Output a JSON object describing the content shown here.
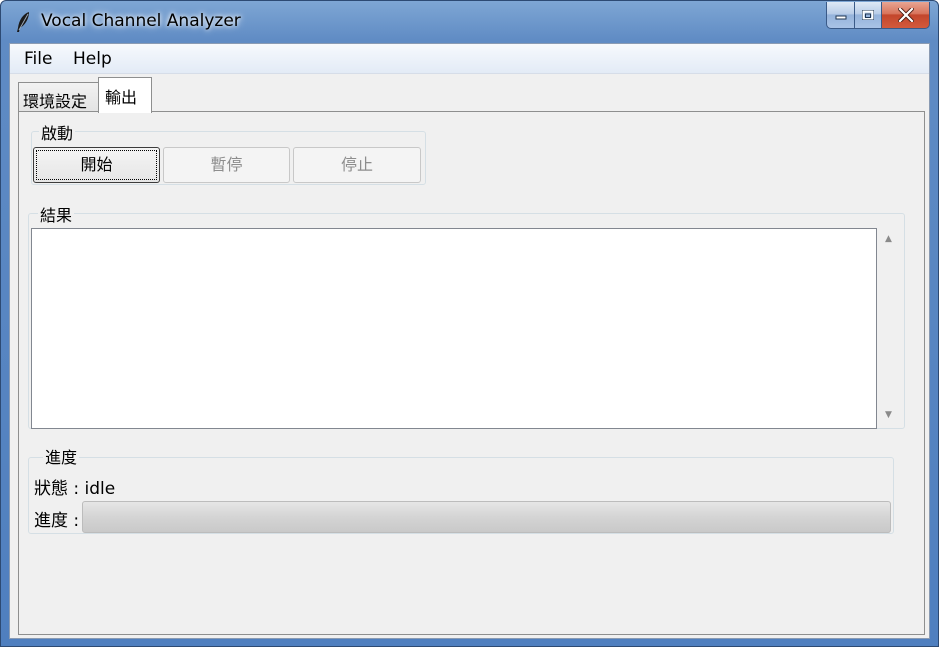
{
  "window": {
    "title": "Vocal Channel Analyzer",
    "app_icon": "feather-icon",
    "controls": {
      "minimize_icon": "minimize-icon",
      "maximize_icon": "maximize-icon",
      "close_icon": "close-icon"
    }
  },
  "menu": {
    "items": [
      "File",
      "Help"
    ]
  },
  "tabs": [
    {
      "label": "環境設定",
      "selected": false
    },
    {
      "label": "輸出",
      "selected": true
    }
  ],
  "start_group": {
    "label": "啟動",
    "buttons": [
      {
        "label": "開始",
        "enabled": true
      },
      {
        "label": "暫停",
        "enabled": false
      },
      {
        "label": "停止",
        "enabled": false
      }
    ]
  },
  "results_group": {
    "label": "結果",
    "text": ""
  },
  "progress_group": {
    "label": "進度",
    "status_label": "狀態 : ",
    "status_value": "idle",
    "progress_label": "進度 :",
    "progress_value": 0
  },
  "colors": {
    "titlebar": "#5f8bc4",
    "close_button": "#c3462c",
    "panel": "#f0f0f0",
    "progress_fill": "#06b025"
  }
}
